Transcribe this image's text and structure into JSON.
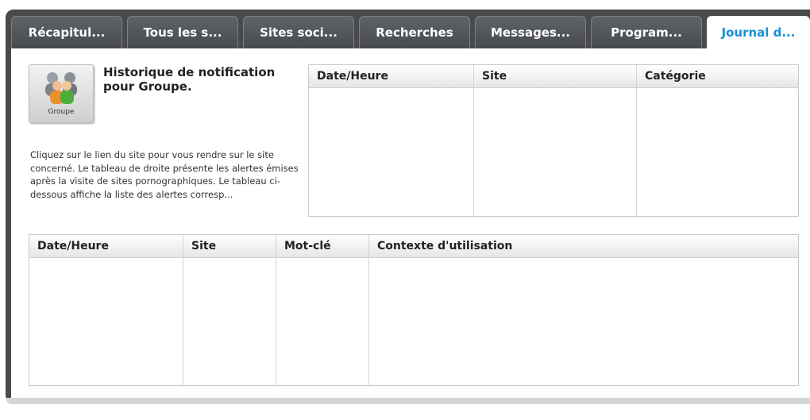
{
  "tabs": [
    {
      "label": "Récapitul...",
      "active": false
    },
    {
      "label": "Tous les s...",
      "active": false
    },
    {
      "label": "Sites soci...",
      "active": false
    },
    {
      "label": "Recherches",
      "active": false
    },
    {
      "label": "Messages...",
      "active": false
    },
    {
      "label": "Program...",
      "active": false
    },
    {
      "label": "Journal d...",
      "active": true
    }
  ],
  "group": {
    "icon": "group-icon",
    "caption": "Groupe"
  },
  "heading": "Historique de notification pour Groupe.",
  "description": "Cliquez sur le lien du site pour vous rendre sur le site concerné. Le tableau de droite présente les alertes émises après la visite de sites pornographiques. Le tableau ci-dessous affiche la liste des alertes corresp...",
  "alerts_table": {
    "columns": [
      "Date/Heure",
      "Site",
      "Catégorie"
    ],
    "rows": []
  },
  "keywords_table": {
    "columns": [
      "Date/Heure",
      "Site",
      "Mot-clé",
      "Contexte d'utilisation"
    ],
    "rows": []
  },
  "colors": {
    "frame": "#4a4a4a",
    "active_tab_text": "#1590d8",
    "tab_text": "#ffffff"
  }
}
